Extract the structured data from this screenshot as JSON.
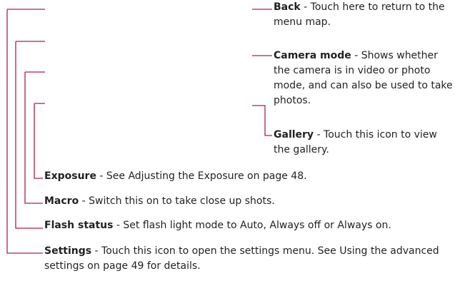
{
  "callouts": {
    "back": {
      "name": "Back",
      "description": " - Touch here to return to the menu map."
    },
    "camera_mode": {
      "name": "Camera mode",
      "description": " - Shows whether the camera is in video or photo mode, and can also be used to take photos."
    },
    "gallery": {
      "name": "Gallery",
      "description": " - Touch this icon to view the gallery."
    },
    "exposure": {
      "name": "Exposure",
      "description": " - See Adjusting the Exposure on page 48."
    },
    "macro": {
      "name": "Macro",
      "description": " - Switch this on to take close up shots."
    },
    "flash_status": {
      "name": "Flash status",
      "description": " - Set flash light mode to Auto, Always off or Always on."
    },
    "settings": {
      "name": "Settings",
      "description": " - Touch this icon to open the settings menu. See Using the advanced settings on page 49  for details."
    }
  },
  "colors": {
    "leader_line": "#b01e45",
    "text": "#231f20"
  }
}
